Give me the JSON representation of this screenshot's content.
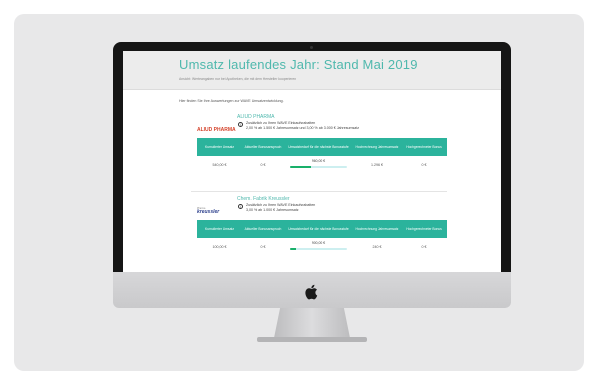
{
  "page": {
    "title": "Umsatz laufendes Jahr: Stand Mai 2019",
    "subtitle": "Ansicht: Werteangaben nur bei Apotheken, die mit dem Hersteller kooperieren",
    "intro": "Hier finden Sie Ihre Auswertungen zur WAVE Umsatzentwicklung."
  },
  "columns": [
    "Kumulierter Umsatz",
    "Aktueller Bonusanspruch",
    "Umsatzbedarf für die nächste Bonusstufe",
    "Hochrechnung Jahresumsatz",
    "Hochgerechneter Bonus"
  ],
  "suppliers": [
    {
      "logo_text": "ALIUD PHARMA",
      "name": "ALIUD PHARMA",
      "info_line1": "Zusätzlich zu Ihren WAVE Einkaufsrabatten",
      "info_line2": "2,00 % ab 1.500 € Jahresumsatz und 3,00 % ab 3.000 € Jahresumsatz",
      "kumulierter_umsatz": "540,00 €",
      "bonusanspruch": "0 €",
      "umsatzbedarf": "960,00 €",
      "progress": 0.36,
      "hochrechnung": "1.296 €",
      "bonus": "0 €"
    },
    {
      "logo_text": "kreussler",
      "logo_sub": "Pharma",
      "name": "Chem. Fabrik Kreussler",
      "info_line1": "Zusätzlich zu Ihren WAVE Einkaufsrabatten",
      "info_line2": "3,00 % ab 1.000 € Jahresumsatz",
      "kumulierter_umsatz": "100,00 €",
      "bonusanspruch": "0 €",
      "umsatzbedarf": "900,00 €",
      "progress": 0.1,
      "hochrechnung": "240 €",
      "bonus": "0 €"
    }
  ],
  "colors": {
    "accent": "#4fb8ad",
    "table_header": "#2bb39c",
    "progress": "#19b06a"
  }
}
